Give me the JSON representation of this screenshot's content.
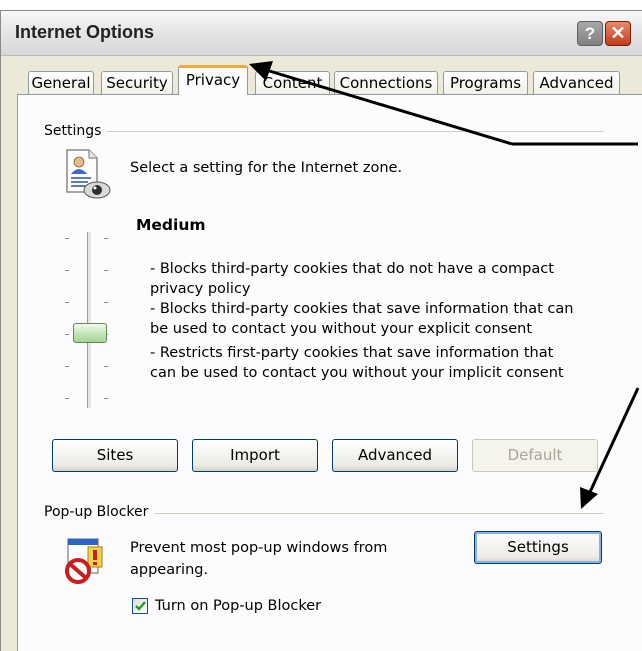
{
  "window": {
    "title": "Internet Options",
    "help_label": "?",
    "close_label": "✕"
  },
  "tabs": [
    {
      "label": "General"
    },
    {
      "label": "Security"
    },
    {
      "label": "Privacy",
      "active": true
    },
    {
      "label": "Content"
    },
    {
      "label": "Connections"
    },
    {
      "label": "Programs"
    },
    {
      "label": "Advanced"
    }
  ],
  "settings": {
    "group_label": "Settings",
    "description": "Select a setting for the Internet zone.",
    "level": "Medium",
    "lines": [
      "- Blocks third-party cookies that do not have a compact",
      "privacy policy",
      "- Blocks third-party cookies that save information that can",
      "be used to contact you without your explicit consent",
      "- Restricts first-party cookies that save information that",
      "can be used to contact you without your implicit consent"
    ],
    "slider_level_index": 3,
    "slider_level_count": 6,
    "buttons": {
      "sites": "Sites",
      "import": "Import",
      "advanced": "Advanced",
      "default": "Default"
    }
  },
  "popup": {
    "group_label": "Pop-up Blocker",
    "description_line1": "Prevent most pop-up windows from",
    "description_line2": "appearing.",
    "settings_button": "Settings",
    "checkbox_label": "Turn on Pop-up Blocker",
    "checkbox_checked": true
  },
  "colors": {
    "active_tab_accent": "#f3a73a",
    "close_button": "#c33c1c",
    "slider_thumb": "#a6d497"
  }
}
